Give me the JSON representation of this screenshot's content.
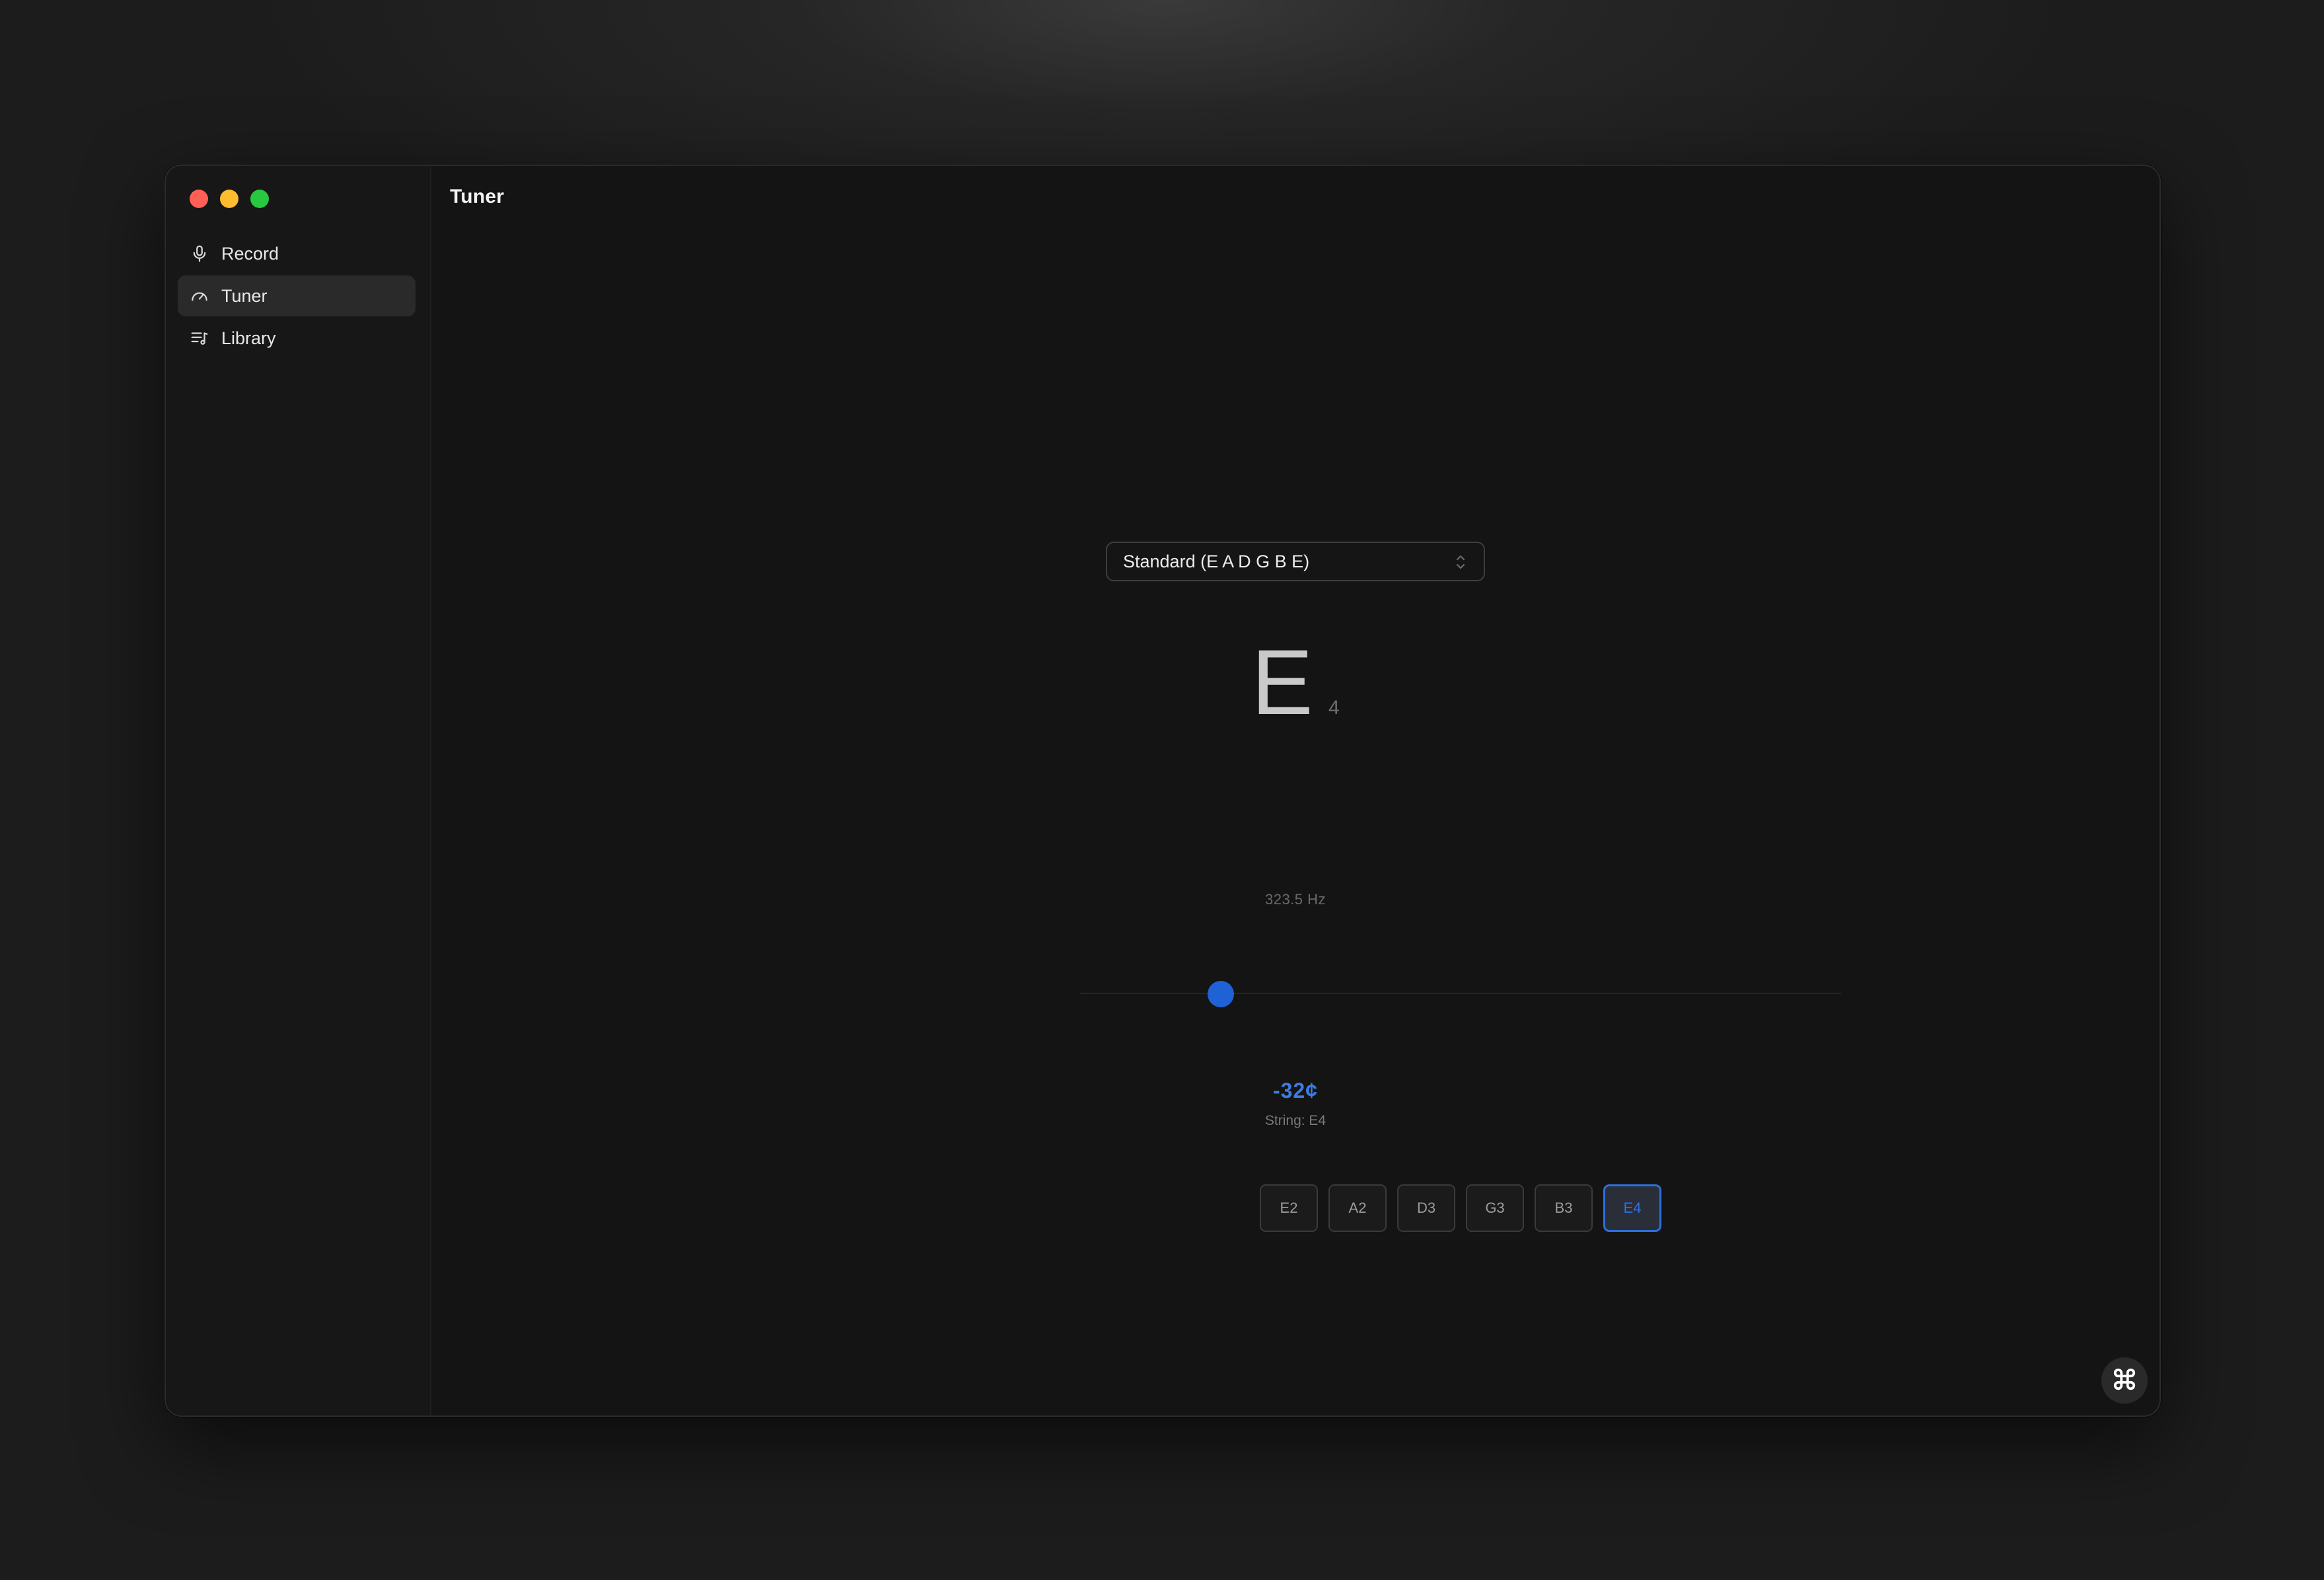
{
  "app": {
    "title": "Tuner"
  },
  "sidebar": {
    "items": [
      {
        "label": "Record",
        "icon": "microphone-icon",
        "active": false
      },
      {
        "label": "Tuner",
        "icon": "gauge-icon",
        "active": true
      },
      {
        "label": "Library",
        "icon": "music-list-icon",
        "active": false
      }
    ]
  },
  "tuner": {
    "tuning": "Standard (E A D G B E)",
    "note": "E",
    "octave": "4",
    "frequency": "323.5 Hz",
    "cents": "-32¢",
    "cents_value": -32,
    "string_label": "String: E4",
    "strings": [
      "E2",
      "A2",
      "D3",
      "G3",
      "B3",
      "E4"
    ],
    "selected_string": "E4"
  },
  "colors": {
    "accent": "#1f62d6",
    "accent_text": "#3d7ce0",
    "window_bg": "#141414",
    "sidebar_bg": "#171717"
  },
  "corner_button": {
    "icon": "command-icon"
  }
}
